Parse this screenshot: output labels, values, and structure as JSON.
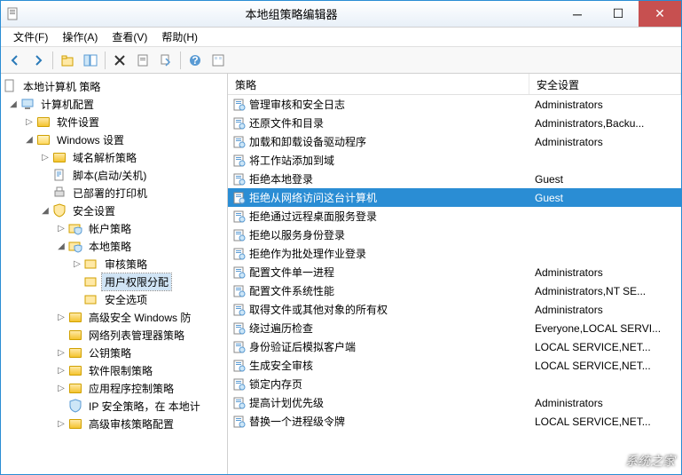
{
  "window": {
    "title": "本地组策略编辑器"
  },
  "menubar": [
    {
      "label": "文件(F)"
    },
    {
      "label": "操作(A)"
    },
    {
      "label": "查看(V)"
    },
    {
      "label": "帮助(H)"
    }
  ],
  "tree": {
    "root": "本地计算机 策略",
    "computer_config": "计算机配置",
    "software_settings": "软件设置",
    "windows_settings": "Windows 设置",
    "dns_policy": "域名解析策略",
    "scripts": "脚本(启动/关机)",
    "deployed_printers": "已部署的打印机",
    "security_settings": "安全设置",
    "account_policies": "帐户策略",
    "local_policies": "本地策略",
    "audit_policy": "审核策略",
    "user_rights": "用户权限分配",
    "security_options": "安全选项",
    "windows_firewall": "高级安全 Windows 防",
    "network_list": "网络列表管理器策略",
    "public_key": "公钥策略",
    "software_restriction": "软件限制策略",
    "app_control": "应用程序控制策略",
    "ip_security": "IP 安全策略，在 本地计",
    "advanced_audit": "高级审核策略配置"
  },
  "list": {
    "header_policy": "策略",
    "header_setting": "安全设置",
    "rows": [
      {
        "policy": "管理审核和安全日志",
        "setting": "Administrators"
      },
      {
        "policy": "还原文件和目录",
        "setting": "Administrators,Backu..."
      },
      {
        "policy": "加载和卸载设备驱动程序",
        "setting": "Administrators"
      },
      {
        "policy": "将工作站添加到域",
        "setting": ""
      },
      {
        "policy": "拒绝本地登录",
        "setting": "Guest"
      },
      {
        "policy": "拒绝从网络访问这台计算机",
        "setting": "Guest",
        "selected": true
      },
      {
        "policy": "拒绝通过远程桌面服务登录",
        "setting": ""
      },
      {
        "policy": "拒绝以服务身份登录",
        "setting": ""
      },
      {
        "policy": "拒绝作为批处理作业登录",
        "setting": ""
      },
      {
        "policy": "配置文件单一进程",
        "setting": "Administrators"
      },
      {
        "policy": "配置文件系统性能",
        "setting": "Administrators,NT SE..."
      },
      {
        "policy": "取得文件或其他对象的所有权",
        "setting": "Administrators"
      },
      {
        "policy": "绕过遍历检查",
        "setting": "Everyone,LOCAL SERVI..."
      },
      {
        "policy": "身份验证后模拟客户端",
        "setting": "LOCAL SERVICE,NET..."
      },
      {
        "policy": "生成安全审核",
        "setting": "LOCAL SERVICE,NET..."
      },
      {
        "policy": "锁定内存页",
        "setting": ""
      },
      {
        "policy": "提高计划优先级",
        "setting": "Administrators"
      },
      {
        "policy": "替换一个进程级令牌",
        "setting": "LOCAL SERVICE,NET..."
      }
    ]
  },
  "watermark": "系统之家"
}
